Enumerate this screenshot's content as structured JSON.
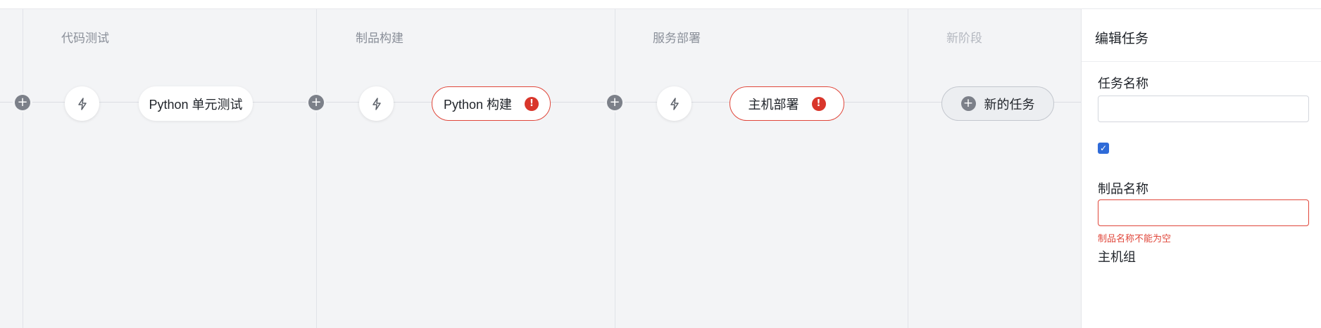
{
  "pipeline": {
    "stages": [
      {
        "title": "代码测试",
        "tasks": [
          {
            "label": "Python 单元测试",
            "status": "ok"
          }
        ]
      },
      {
        "title": "制品构建",
        "tasks": [
          {
            "label": "Python 构建",
            "status": "error"
          }
        ]
      },
      {
        "title": "服务部署",
        "tasks": [
          {
            "label": "主机部署",
            "status": "error"
          }
        ]
      },
      {
        "title": "新阶段",
        "tasks": []
      }
    ],
    "new_task_label": "新的任务",
    "error_symbol": "!",
    "add_symbol": "+"
  },
  "panel": {
    "title": "编辑任务",
    "fields": [
      {
        "label": "任务名称",
        "value": ""
      },
      {
        "label": "制品名称",
        "value": ""
      },
      {
        "label": "主机组",
        "value": ""
      }
    ],
    "checkbox_label": "",
    "error_text": "制品名称不能为空"
  },
  "colors": {
    "canvas_bg": "#f3f4f6",
    "error": "#d9362b",
    "accent": "#2f6bd8"
  },
  "icons": {
    "trigger": "lightning-bolt-icon",
    "add": "plus-circle-icon",
    "error": "exclamation-circle-icon"
  }
}
